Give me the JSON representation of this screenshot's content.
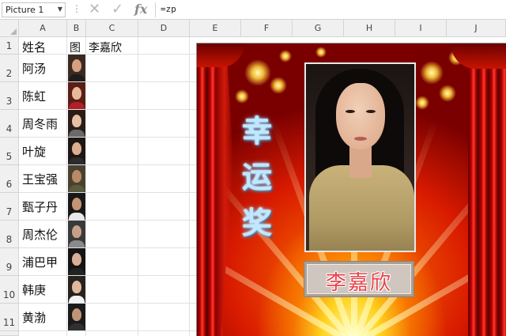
{
  "formula_bar": {
    "name_box": "Picture 1",
    "name_box_arrow": "▼",
    "dots": "⋮",
    "cancel_glyph": "✕",
    "enter_glyph": "✓",
    "fx_glyph": "fx",
    "formula": "=zp"
  },
  "columns": [
    "A",
    "B",
    "C",
    "D",
    "E",
    "F",
    "G",
    "H",
    "I",
    "J"
  ],
  "rows": [
    "1",
    "2",
    "3",
    "4",
    "5",
    "6",
    "7",
    "8",
    "9",
    "10",
    "11"
  ],
  "header_row": {
    "a1": "姓名",
    "b1": "图",
    "c1": "李嘉欣"
  },
  "names": [
    "阿汤",
    "陈虹",
    "周冬雨",
    "叶旋",
    "王宝强",
    "甄子丹",
    "周杰伦",
    "浦巴甲",
    "韩庚",
    "黄渤"
  ],
  "picture": {
    "lucky_text": "幸运奖",
    "winner_name": "李嘉欣",
    "colors": {
      "background_center": "#ffd21f",
      "background_edge": "#7a0000",
      "curtain": "#b50000",
      "lucky_text": "#bfe8ff",
      "name_text": "#e7434a"
    }
  },
  "icons": {
    "cancel": "cancel-icon",
    "enter": "enter-icon",
    "function": "function-icon"
  }
}
